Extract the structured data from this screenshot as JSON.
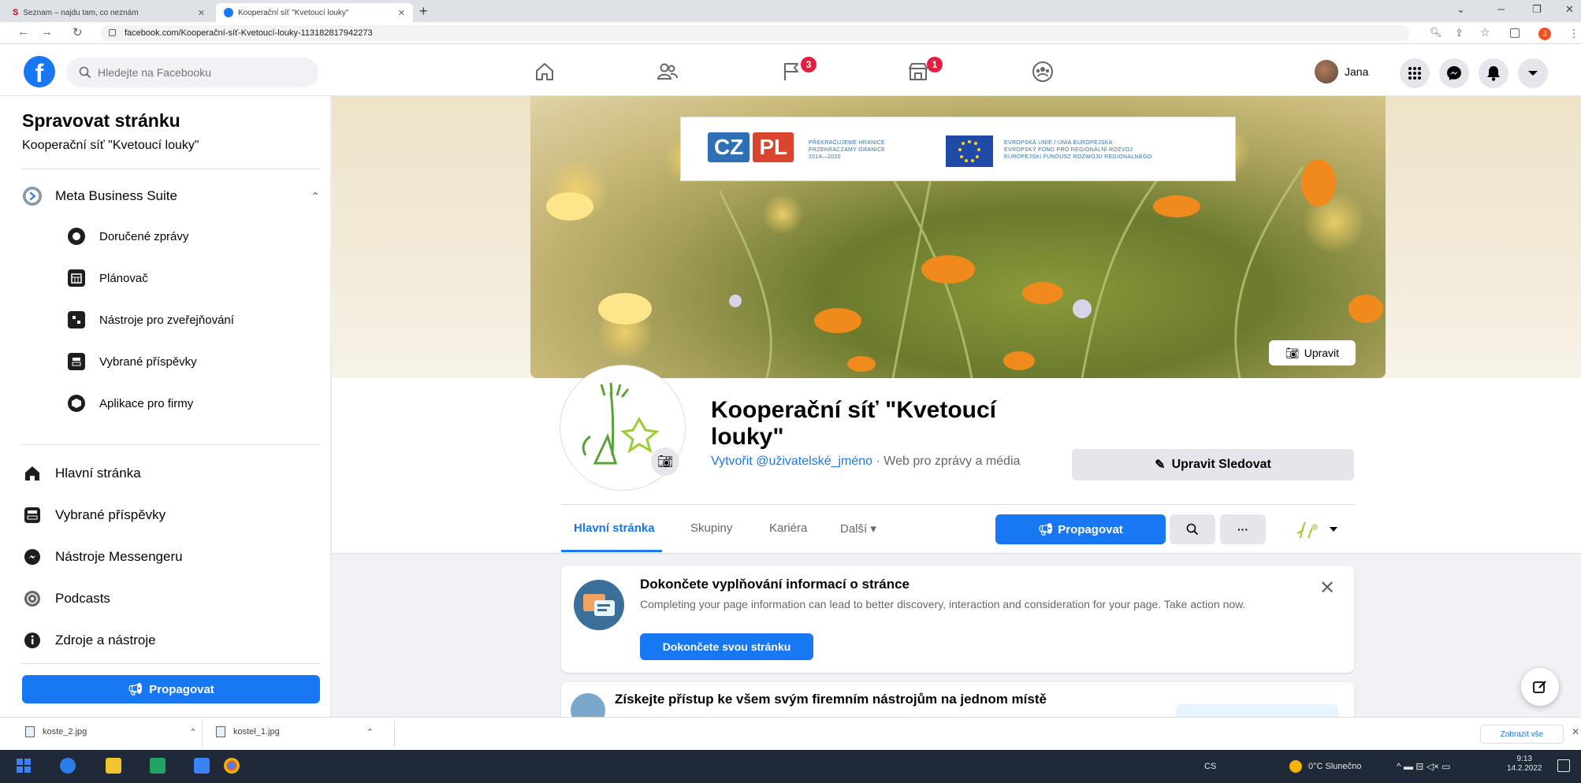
{
  "browser": {
    "tabs": [
      {
        "title": "Seznam – najdu tam, co neznám"
      },
      {
        "title": "Kooperační síť \"Kvetoucí louky\""
      }
    ],
    "url": "facebook.com/Kooperační-síť-Kvetoucí-louky-113182817942273"
  },
  "fb": {
    "logo": "f",
    "search_placeholder": "Hledejte na Facebooku",
    "badges": {
      "pages": "3",
      "marketplace": "1"
    },
    "user_name": "Jana"
  },
  "sidebar": {
    "title": "Spravovat stránku",
    "page_name": "Kooperační síť \"Kvetoucí louky\"",
    "meta_suite": "Meta Business Suite",
    "sub_items": [
      {
        "label": "Doručené zprávy"
      },
      {
        "label": "Plánovač"
      },
      {
        "label": "Nástroje pro zveřejňování"
      },
      {
        "label": "Vybrané příspěvky"
      },
      {
        "label": "Aplikace pro firmy"
      }
    ],
    "items": [
      {
        "label": "Hlavní stránka"
      },
      {
        "label": "Vybrané příspěvky"
      },
      {
        "label": "Nástroje Messengeru"
      },
      {
        "label": "Podcasts"
      },
      {
        "label": "Zdroje a nástroje"
      }
    ],
    "promote_label": "Propagovat"
  },
  "cover": {
    "banner_left_1": "PŘEKRAČUJEME HRANICE",
    "banner_left_2": "PRZEKRACZAMY GRANICE",
    "banner_left_3": "2014—2020",
    "banner_right_1": "EVROPSKÁ UNIE / UNIA EUROPEJSKA",
    "banner_right_2": "EVROPSKÝ FOND PRO REGIONÁLNÍ ROZVOJ",
    "banner_right_3": "EUROPEJSKI FUNDUSZ ROZWOJU REGIONALNEGO",
    "edit_label": "Upravit"
  },
  "page": {
    "name": "Kooperační síť \"Kvetoucí louky\"",
    "create_username": "Vytvořit @uživatelské_jméno",
    "category": " · Web pro zprávy a média",
    "edit_follow_label": "Upravit Sledovat",
    "tabs": [
      {
        "label": "Hlavní stránka"
      },
      {
        "label": "Skupiny"
      },
      {
        "label": "Kariéra"
      },
      {
        "label": "Další ▾"
      }
    ],
    "promote_label": "Propagovat",
    "more_label": "···"
  },
  "cards": {
    "complete_title": "Dokončete vyplňování informací o stránce",
    "complete_desc": "Completing your page information can lead to better discovery, interaction and consideration for your page. Take action now.",
    "complete_button": "Dokončete svou stránku",
    "tools_title": "Získejte přístup ke všem svým firemním nástrojům na jednom místě"
  },
  "downloads": {
    "files": [
      {
        "name": "koste_2.jpg"
      },
      {
        "name": "kostel_1.jpg"
      }
    ],
    "show_all": "Zobrazit vše"
  },
  "taskbar": {
    "lang": "CS",
    "weather": "0°C Slunečno",
    "time": "9:13",
    "date": "14.2.2022"
  },
  "colors": {
    "fb_blue": "#1877f2",
    "badge_red": "#e41e3f"
  }
}
